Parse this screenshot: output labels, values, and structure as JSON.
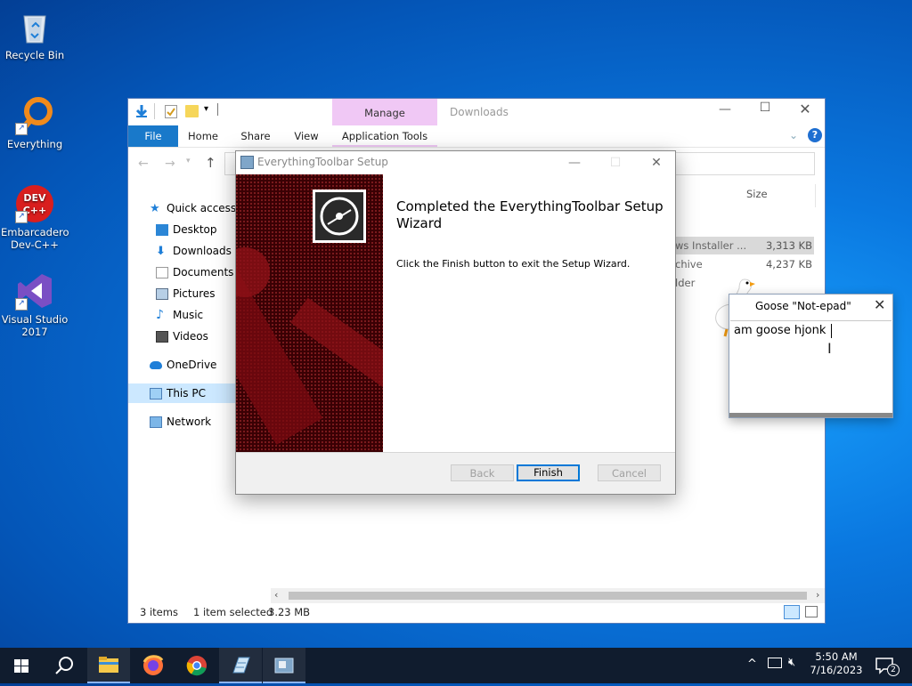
{
  "desktop": {
    "icons": [
      {
        "label": "Recycle Bin"
      },
      {
        "label": "Everything"
      },
      {
        "label": "Embarcadero Dev-C++",
        "line1": "Embarcadero",
        "line2": "Dev-C++"
      },
      {
        "label": "Visual Studio 2017",
        "line1": "Visual Studio",
        "line2": "2017"
      }
    ]
  },
  "explorer": {
    "context_tab": "Manage",
    "title": "Downloads",
    "tabs": [
      "File",
      "Home",
      "Share",
      "View",
      "Application Tools"
    ],
    "column_size": "Size",
    "nav": {
      "quick_access": "Quick access",
      "desktop": "Desktop",
      "downloads": "Downloads",
      "documents": "Documents",
      "pictures": "Pictures",
      "music": "Music",
      "videos": "Videos",
      "onedrive": "OneDrive",
      "this_pc": "This PC",
      "network": "Network"
    },
    "files": [
      {
        "type": "ws Installer ...",
        "size": "3,313 KB"
      },
      {
        "type": "chive",
        "size": "4,237 KB"
      },
      {
        "type": "lder",
        "size": ""
      }
    ],
    "status": {
      "items": "3 items",
      "selected": "1 item selected",
      "size": "3.23 MB"
    }
  },
  "setup": {
    "title": "EverythingToolbar Setup",
    "heading": "Completed the EverythingToolbar Setup Wizard",
    "heading_line1": "Completed the EverythingToolbar Setup",
    "heading_line2": "Wizard",
    "body": "Click the Finish button to exit the Setup Wizard.",
    "buttons": {
      "back": "Back",
      "finish": "Finish",
      "cancel": "Cancel"
    }
  },
  "notepad": {
    "title": "Goose \"Not-epad\"",
    "text": "am goose hjonk"
  },
  "taskbar": {
    "time": "5:50 AM",
    "date": "7/16/2023",
    "notification_count": "2"
  },
  "colors": {
    "accent": "#0078d7",
    "manage_tab": "#f0c8f5",
    "banner": "#3a0004",
    "taskbar": "#101c2e"
  }
}
